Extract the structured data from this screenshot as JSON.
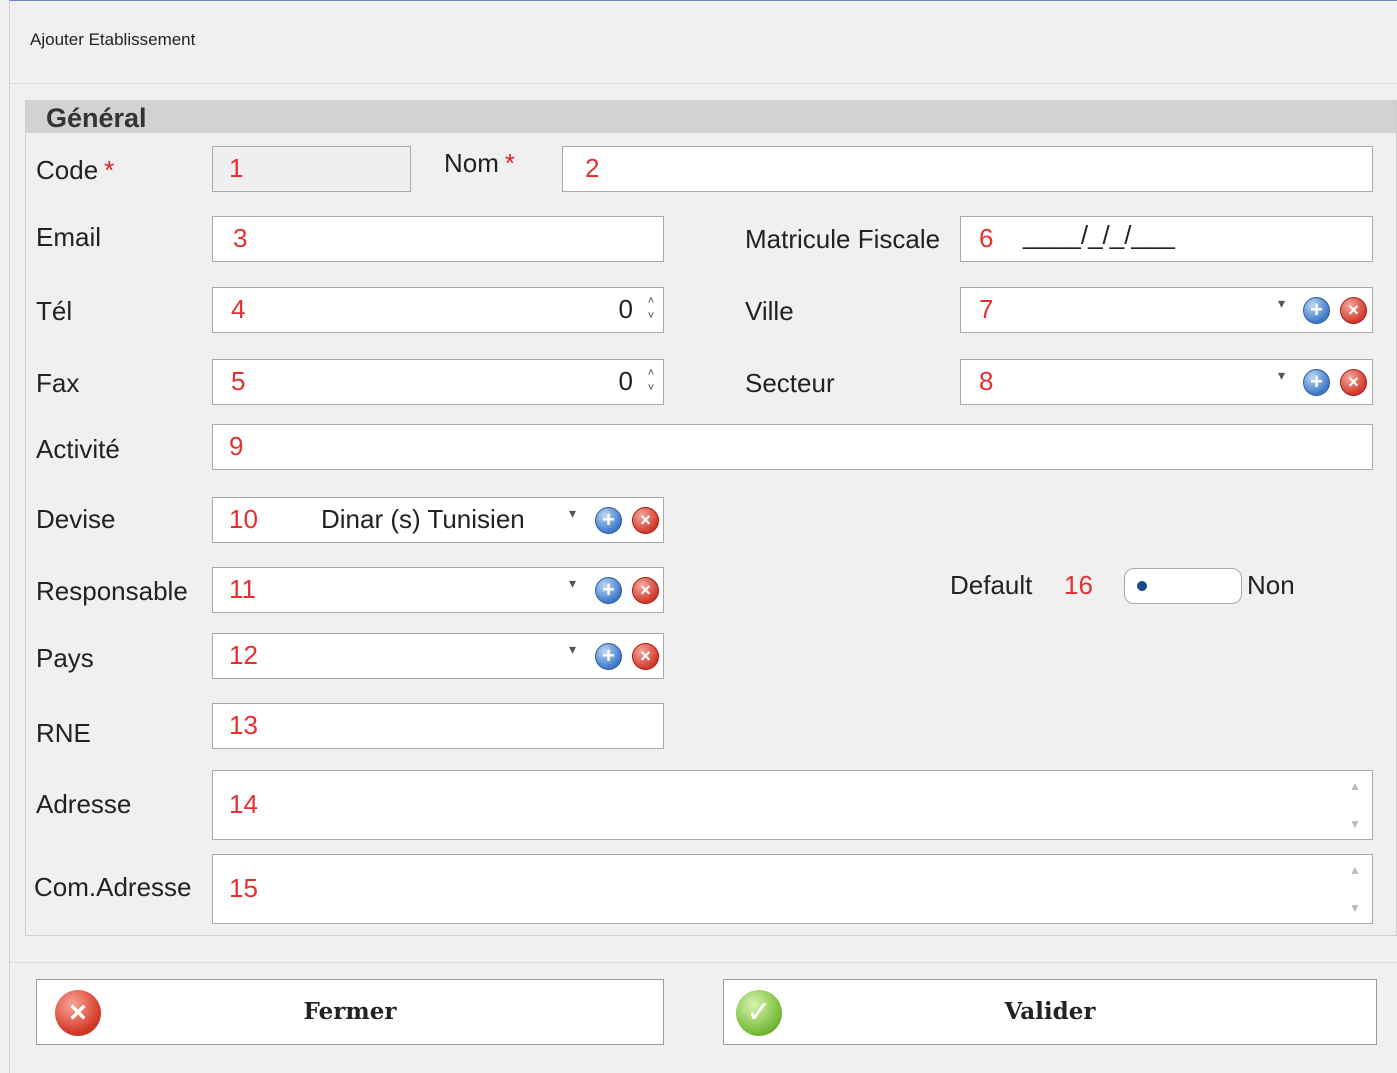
{
  "window": {
    "title": "Ajouter Etablissement"
  },
  "group": {
    "title": "Général"
  },
  "required_mark": "*",
  "fields": {
    "code": {
      "label": "Code",
      "number": "1"
    },
    "nom": {
      "label": "Nom",
      "number": "2"
    },
    "email": {
      "label": "Email",
      "number": "3"
    },
    "tel": {
      "label": "Tél",
      "number": "4",
      "value": "0"
    },
    "fax": {
      "label": "Fax",
      "number": "5",
      "value": "0"
    },
    "matricule": {
      "label": "Matricule Fiscale",
      "number": "6",
      "mask": "____/_/_/___"
    },
    "ville": {
      "label": "Ville",
      "number": "7"
    },
    "secteur": {
      "label": "Secteur",
      "number": "8"
    },
    "activite": {
      "label": "Activité",
      "number": "9"
    },
    "devise": {
      "label": "Devise",
      "number": "10",
      "value": "Dinar (s) Tunisien"
    },
    "responsable": {
      "label": "Responsable",
      "number": "11"
    },
    "pays": {
      "label": "Pays",
      "number": "12"
    },
    "rne": {
      "label": "RNE",
      "number": "13"
    },
    "adresse": {
      "label": "Adresse",
      "number": "14"
    },
    "com_adresse": {
      "label": "Com.Adresse",
      "number": "15"
    },
    "default": {
      "label": "Default",
      "number": "16",
      "state": "Non"
    }
  },
  "icons": {
    "plus": "+",
    "close": "×",
    "check": "✓",
    "dropdown": "▾",
    "spin_up": "˄",
    "spin_down": "˅"
  },
  "buttons": {
    "fermer": "Fermer",
    "valider": "Valider"
  }
}
